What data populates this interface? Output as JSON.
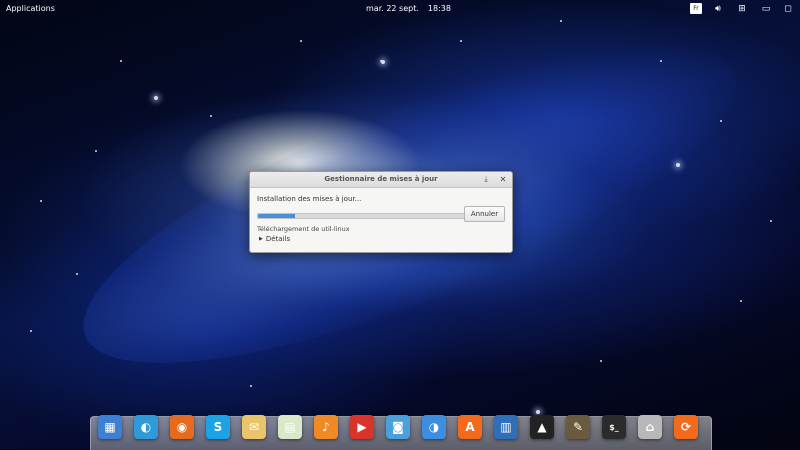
{
  "top_panel": {
    "applications_label": "Applications",
    "date": "mar. 22 sept.",
    "time": "18:38",
    "keyboard_layout": "Fr"
  },
  "dialog": {
    "title": "Gestionnaire de mises à jour",
    "status_heading": "Installation des mises à jour...",
    "progress_percent": 18,
    "cancel_label": "Annuler",
    "download_status": "Téléchargement de util-linux",
    "details_label": "Détails",
    "accent_color": "#4a8fd8"
  },
  "dock": {
    "items": [
      {
        "name": "multitasking-view-icon",
        "glyph": "▦",
        "color": "#3d7fd0"
      },
      {
        "name": "web-browser-icon",
        "glyph": "◐",
        "color": "#2f9ad8"
      },
      {
        "name": "firefox-icon",
        "glyph": "◉",
        "color": "#e66b1f"
      },
      {
        "name": "skype-icon",
        "glyph": "S",
        "color": "#1ba3e6"
      },
      {
        "name": "mail-icon",
        "glyph": "✉",
        "color": "#e9c46a"
      },
      {
        "name": "calendar-icon",
        "glyph": "▤",
        "color": "#d8e8c8"
      },
      {
        "name": "music-icon",
        "glyph": "♪",
        "color": "#f08a24"
      },
      {
        "name": "video-player-icon",
        "glyph": "▶",
        "color": "#d9342b"
      },
      {
        "name": "photos-icon",
        "glyph": "◙",
        "color": "#4aa0d8"
      },
      {
        "name": "settings-toggle-icon",
        "glyph": "◑",
        "color": "#3c8ee0"
      },
      {
        "name": "app-center-icon",
        "glyph": "A",
        "color": "#f26b1d"
      },
      {
        "name": "document-viewer-icon",
        "glyph": "▥",
        "color": "#2f6fb8"
      },
      {
        "name": "inkscape-icon",
        "glyph": "▲",
        "color": "#222222"
      },
      {
        "name": "gimp-icon",
        "glyph": "✎",
        "color": "#6b5a3c"
      },
      {
        "name": "terminal-icon",
        "glyph": "$_",
        "color": "#2b2b2b"
      },
      {
        "name": "files-icon",
        "glyph": "⌂",
        "color": "#b8b8b8"
      },
      {
        "name": "update-manager-icon",
        "glyph": "⟳",
        "color": "#f26b1d"
      }
    ]
  }
}
